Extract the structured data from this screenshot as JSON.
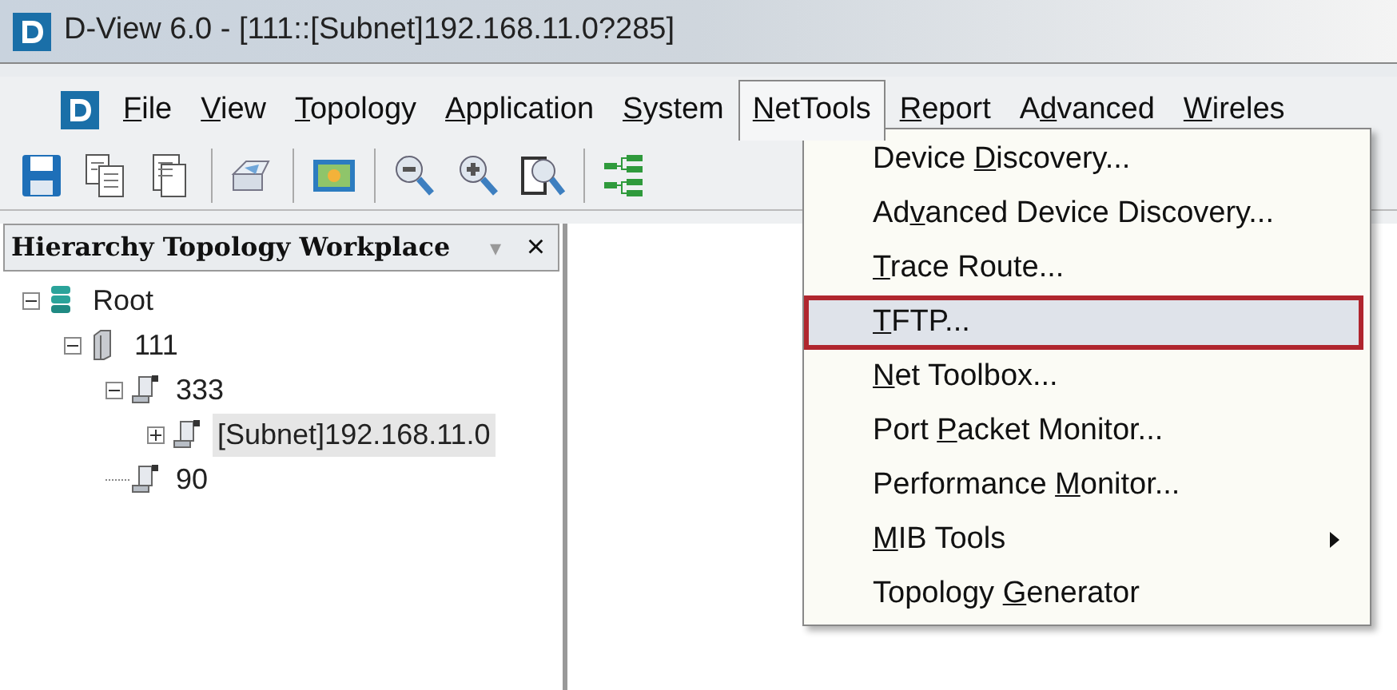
{
  "window": {
    "title": "D-View 6.0 - [111::[Subnet]192.168.11.0?285]"
  },
  "menu_bar": [
    {
      "label": {
        "key": "F",
        "after": "ile"
      },
      "selected": false
    },
    {
      "label": {
        "key": "V",
        "after": "iew"
      },
      "selected": false
    },
    {
      "label": {
        "key": "T",
        "after": "opology"
      },
      "selected": false
    },
    {
      "label": {
        "key": "A",
        "after": "pplication"
      },
      "selected": false
    },
    {
      "label": {
        "key": "S",
        "after": "ystem"
      },
      "selected": false
    },
    {
      "label": {
        "key": "N",
        "after": "etTools"
      },
      "selected": true
    },
    {
      "label": {
        "key": "R",
        "after": "eport"
      },
      "selected": false
    },
    {
      "label": {
        "before": "A",
        "key": "d",
        "after": "vanced"
      },
      "selected": false
    },
    {
      "label": {
        "key": "W",
        "after": "ireles"
      },
      "selected": false
    }
  ],
  "toolbar": [
    {
      "kind": "save"
    },
    {
      "kind": "copy"
    },
    {
      "kind": "paste"
    },
    {
      "kind": "sep"
    },
    {
      "kind": "print"
    },
    {
      "kind": "sep"
    },
    {
      "kind": "image"
    },
    {
      "kind": "sep"
    },
    {
      "kind": "zoom-out"
    },
    {
      "kind": "zoom-in"
    },
    {
      "kind": "zoom-page"
    },
    {
      "kind": "sep"
    },
    {
      "kind": "tree"
    }
  ],
  "panel": {
    "title": "Hierarchy Topology Workplace",
    "pin": "▾",
    "close": "×"
  },
  "tree": [
    {
      "label": "Root",
      "kind": "database",
      "expanded": true,
      "selected": false,
      "children": [
        {
          "label": "111",
          "kind": "server",
          "expanded": true,
          "selected": false,
          "children": [
            {
              "label": "333",
              "kind": "workstation",
              "expanded": true,
              "selected": false,
              "children": [
                {
                  "label": "[Subnet]192.168.11.0",
                  "kind": "workstation",
                  "expanded": false,
                  "selected": true
                }
              ]
            },
            {
              "label": "90",
              "kind": "workstation",
              "selected": false
            }
          ]
        }
      ]
    }
  ],
  "dropdown": [
    {
      "label": {
        "before": "Device ",
        "key": "D",
        "after": "iscovery..."
      },
      "selected": false
    },
    {
      "label": {
        "before": "Ad",
        "key": "v",
        "after": "anced Device Discovery..."
      },
      "selected": false
    },
    {
      "label": {
        "key": "T",
        "after": "race Route..."
      },
      "selected": false
    },
    {
      "label": {
        "key": "T",
        "after": "FTP..."
      },
      "selected": true
    },
    {
      "label": {
        "key": "N",
        "after": "et Toolbox..."
      },
      "selected": false
    },
    {
      "label": {
        "before": "Port ",
        "key": "P",
        "after": "acket Monitor..."
      },
      "selected": false
    },
    {
      "label": {
        "before": "Performance ",
        "key": "M",
        "after": "onitor..."
      },
      "selected": false
    },
    {
      "label": {
        "key": "M",
        "after": "IB Tools"
      },
      "selected": false,
      "submenu": true
    },
    {
      "label": {
        "before": "Topology ",
        "key": "G",
        "after": "enerator"
      },
      "selected": false
    }
  ]
}
